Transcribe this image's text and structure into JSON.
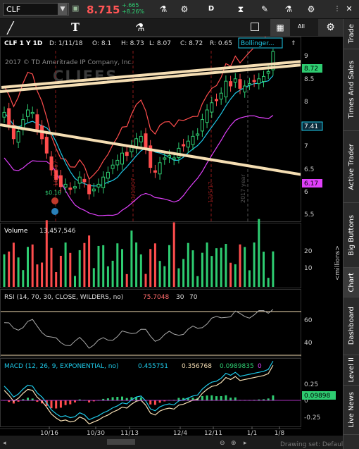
{
  "symbol": "CLF",
  "price": "8.715",
  "change_abs": "+.665",
  "change_pct": "+8.26%",
  "toolbar_buttons": [
    {
      "name": "flask-icon",
      "glyph": "⚗"
    },
    {
      "name": "gear-icon",
      "glyph": "⚙"
    },
    {
      "name": "drawing-d-button",
      "glyph": "D"
    },
    {
      "name": "candle-icon",
      "glyph": "⧗"
    },
    {
      "name": "pencil-icon",
      "glyph": "✎"
    },
    {
      "name": "flask2-icon",
      "glyph": "⚗"
    },
    {
      "name": "gear2-icon",
      "glyph": "⚙"
    }
  ],
  "toolbar2": {
    "draw_line": "╱",
    "text_tool": "T",
    "studies": "⚗",
    "all": "All"
  },
  "price_panel": {
    "legend": {
      "period": "CLF 1 Y 1D",
      "date": "D: 1/11/18",
      "open": "O: 8.1",
      "high": "H: 8.73",
      "low": "L: 8.07",
      "close": "C: 8.72",
      "range": "R: 0.65",
      "study": "Bollinger..."
    },
    "copyright": "2017 © TD Ameritrade IP Company, Inc.",
    "watermark": "CLIFFS",
    "yticks": [
      "9",
      "8.5",
      "8",
      "7",
      "6.5",
      "6",
      "5.5"
    ],
    "badges": [
      {
        "label": "8.72",
        "color": "#2ecc71"
      },
      {
        "label": "7.41",
        "color": "#1ec9e8"
      },
      {
        "label": "6.17",
        "color": "#e040fb"
      }
    ],
    "markers": [
      "10/17/17",
      "11/13/17",
      "12/5/17",
      "2017 year"
    ],
    "div_label": "$0.16"
  },
  "volume_panel": {
    "label": "Volume",
    "value": "13,457,546",
    "yticks": [
      "20",
      "10"
    ],
    "units": "<millions>"
  },
  "rsi_panel": {
    "label": "RSI (14, 70, 30, CLOSE, WILDERS, no)",
    "value": "75.7048",
    "ob": "30",
    "os": "70",
    "yticks": [
      "60",
      "40"
    ]
  },
  "macd_panel": {
    "label": "MACD (12, 26, 9, EXPONENTIAL, no)",
    "v1": "0.455751",
    "v2": "0.356768",
    "v3": "0.0989835",
    "v4": "0",
    "yticks": [
      "0.25",
      "0",
      "-0.25"
    ],
    "badge": "0.09898"
  },
  "xaxis": [
    "10/16",
    "10/30",
    "11/13",
    "12/4",
    "12/11",
    "1/1",
    "1/8"
  ],
  "status": "Drawing set: Default",
  "tabs": [
    "Trade",
    "Times And Sales",
    "Active Trader",
    "Big Buttons",
    "Chart",
    "Dashboard",
    "Level II",
    "Live News"
  ],
  "colors": {
    "up": "#2ecc71",
    "down": "#ff4d4d",
    "trend": "#f5deb3",
    "bb_upper": "#ff4d4d",
    "bb_mid": "#1ec9e8",
    "bb_lower": "#e040fb"
  }
}
